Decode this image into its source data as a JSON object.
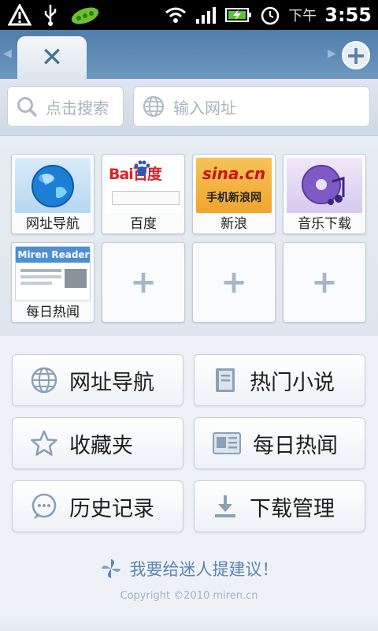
{
  "status_bar": {
    "icons": [
      "warning-icon",
      "usb-icon",
      "peapod-app-icon",
      "wifi-icon",
      "signal-icon",
      "battery-charging-icon",
      "alarm-icon"
    ],
    "ampm": "下午",
    "time": "3:55"
  },
  "tabs": {
    "close_symbol": "✕",
    "new_tab_symbol": "+"
  },
  "search": {
    "search_placeholder": "点击搜索",
    "url_placeholder": "输入网址"
  },
  "speed_dial": [
    {
      "label": "网址导航",
      "icon": "globe-icon"
    },
    {
      "label": "百度",
      "icon": "baidu-logo",
      "thumb_text": "Bai百度"
    },
    {
      "label": "新浪",
      "icon": "sina-logo",
      "thumb_text": "sina.cn",
      "thumb_sub": "手机新浪网"
    },
    {
      "label": "音乐下载",
      "icon": "music-cd-icon"
    },
    {
      "label": "每日热闻",
      "icon": "miren-reader-thumb",
      "thumb_text": "Miren Reader"
    }
  ],
  "empty_tile_symbol": "+",
  "buttons": [
    {
      "label": "网址导航",
      "icon": "globe-icon"
    },
    {
      "label": "热门小说",
      "icon": "book-icon"
    },
    {
      "label": "收藏夹",
      "icon": "star-icon"
    },
    {
      "label": "每日热闻",
      "icon": "news-icon"
    },
    {
      "label": "历史记录",
      "icon": "history-chat-icon"
    },
    {
      "label": "下载管理",
      "icon": "download-icon"
    }
  ],
  "suggest_text": "我要给迷人提建议！",
  "copyright": "Copyright ©2010 miren.cn",
  "colors": {
    "tabbar": "#5b88b4",
    "accent": "#5c86b3",
    "background": "#eef2f7"
  }
}
